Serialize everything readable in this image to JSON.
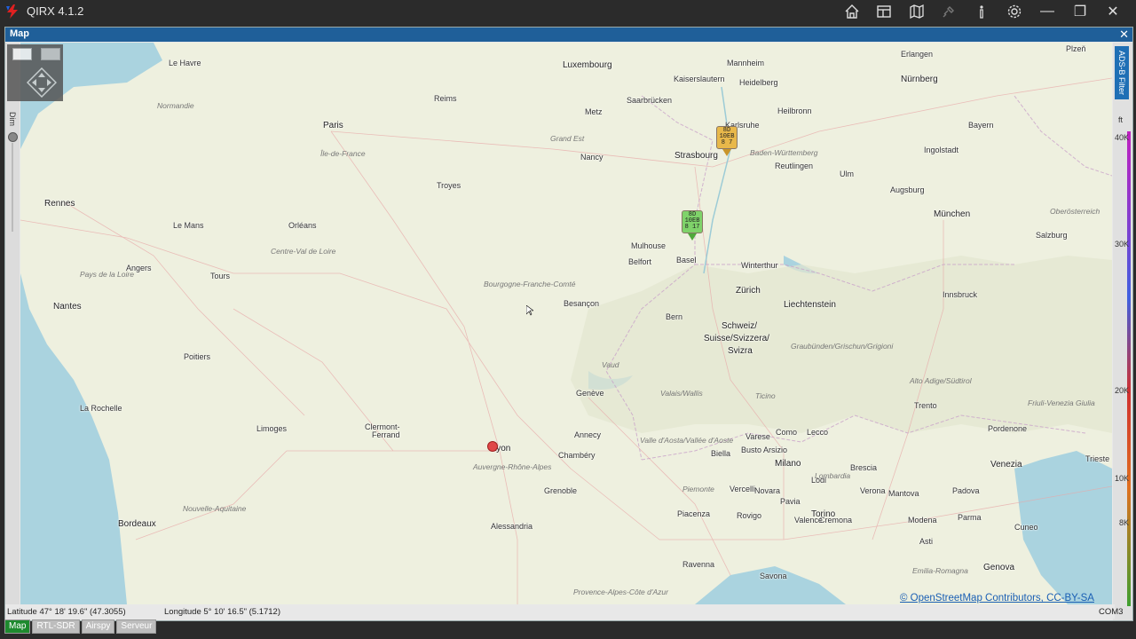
{
  "app": {
    "title": "QIRX 4.1.2"
  },
  "toolbar": {
    "icons": [
      "home-icon",
      "layout-icon",
      "map-icon",
      "satellite-icon",
      "info-icon",
      "gear-icon"
    ]
  },
  "window_controls": {
    "minimize": "—",
    "restore": "❐",
    "close": "✕"
  },
  "panel": {
    "title": "Map",
    "close": "✕"
  },
  "map": {
    "dim_label": "Dim",
    "ads_filter_label": "ADS-B Filter",
    "altitude_unit": "ft",
    "altitude_ticks": [
      "40K",
      "30K",
      "20K",
      "10K",
      "8K"
    ],
    "cities": [
      {
        "name": "Le Havre",
        "big": false
      },
      {
        "name": "Luxembourg",
        "big": true
      },
      {
        "name": "Mannheim",
        "big": false
      },
      {
        "name": "Erlangen",
        "big": false
      },
      {
        "name": "Plzeň",
        "big": false
      },
      {
        "name": "Heidelberg",
        "big": false
      },
      {
        "name": "Nürnberg",
        "big": true
      },
      {
        "name": "Kaiserslautern",
        "big": false
      },
      {
        "name": "Saarbrücken",
        "big": false
      },
      {
        "name": "Reims",
        "big": false
      },
      {
        "name": "Metz",
        "big": false
      },
      {
        "name": "Paris",
        "big": true
      },
      {
        "name": "Karlsruhe",
        "big": false
      },
      {
        "name": "Heilbronn",
        "big": false
      },
      {
        "name": "Bayern",
        "big": false
      },
      {
        "name": "Strasbourg",
        "big": true
      },
      {
        "name": "Reutlingen",
        "big": false
      },
      {
        "name": "Ingolstadt",
        "big": false
      },
      {
        "name": "Nancy",
        "big": false
      },
      {
        "name": "Troyes",
        "big": false
      },
      {
        "name": "Augsburg",
        "big": false
      },
      {
        "name": "Rennes",
        "big": true
      },
      {
        "name": "Ulm",
        "big": false
      },
      {
        "name": "München",
        "big": true
      },
      {
        "name": "Le Mans",
        "big": false
      },
      {
        "name": "Orléans",
        "big": false
      },
      {
        "name": "Mulhouse",
        "big": false
      },
      {
        "name": "Salzburg",
        "big": false
      },
      {
        "name": "Belfort",
        "big": false
      },
      {
        "name": "Basel",
        "big": false
      },
      {
        "name": "Winterthur",
        "big": false
      },
      {
        "name": "Angers",
        "big": false
      },
      {
        "name": "Tours",
        "big": false
      },
      {
        "name": "Zürich",
        "big": true
      },
      {
        "name": "Innsbruck",
        "big": false
      },
      {
        "name": "Nantes",
        "big": true
      },
      {
        "name": "Besançon",
        "big": false
      },
      {
        "name": "Liechtenstein",
        "big": true
      },
      {
        "name": "Bern",
        "big": false
      },
      {
        "name": "Schweiz/",
        "big": true
      },
      {
        "name": "Suisse/Svizzera/",
        "big": true
      },
      {
        "name": "Svizra",
        "big": true
      },
      {
        "name": "Poitiers",
        "big": false
      },
      {
        "name": "Genève",
        "big": false
      },
      {
        "name": "Trento",
        "big": false
      },
      {
        "name": "La Rochelle",
        "big": false
      },
      {
        "name": "Limoges",
        "big": false
      },
      {
        "name": "Clermont-",
        "big": false
      },
      {
        "name": "Ferrand",
        "big": false
      },
      {
        "name": "Annecy",
        "big": false
      },
      {
        "name": "Como",
        "big": false
      },
      {
        "name": "Lecco",
        "big": false
      },
      {
        "name": "Varese",
        "big": false
      },
      {
        "name": "Pordenone",
        "big": false
      },
      {
        "name": "Lyon",
        "big": true
      },
      {
        "name": "Chambéry",
        "big": false
      },
      {
        "name": "Biella",
        "big": false
      },
      {
        "name": "Busto Arsizio",
        "big": false
      },
      {
        "name": "Milano",
        "big": true
      },
      {
        "name": "Brescia",
        "big": false
      },
      {
        "name": "Verona",
        "big": false
      },
      {
        "name": "Padova",
        "big": false
      },
      {
        "name": "Venezia",
        "big": true
      },
      {
        "name": "Trieste",
        "big": false
      },
      {
        "name": "Grenoble",
        "big": false
      },
      {
        "name": "Lodi",
        "big": false
      },
      {
        "name": "Vercelli",
        "big": false
      },
      {
        "name": "Novara",
        "big": false
      },
      {
        "name": "Bordeaux",
        "big": true
      },
      {
        "name": "Cremona",
        "big": false
      },
      {
        "name": "Mantova",
        "big": false
      },
      {
        "name": "Pavia",
        "big": false
      },
      {
        "name": "Torino",
        "big": true
      },
      {
        "name": "Piacenza",
        "big": false
      },
      {
        "name": "Valence",
        "big": false
      },
      {
        "name": "Alessandria",
        "big": false
      },
      {
        "name": "Rovigo",
        "big": false
      },
      {
        "name": "Parma",
        "big": false
      },
      {
        "name": "Modena",
        "big": false
      },
      {
        "name": "Asti",
        "big": false
      },
      {
        "name": "Cuneo",
        "big": false
      },
      {
        "name": "Ravenna",
        "big": false
      },
      {
        "name": "Genova",
        "big": true
      },
      {
        "name": "Savona",
        "big": false
      }
    ],
    "regions": [
      "Normandie",
      "Île-de-France",
      "Grand Est",
      "Baden-Württemberg",
      "Centre-Val de Loire",
      "Pays de la Loire",
      "Bourgogne-Franche-Comté",
      "Auvergne-Rhône-Alpes",
      "Nouvelle-Aquitaine",
      "Lombardia",
      "Piemonte",
      "Emilia-Romagna",
      "Provence-Alpes-Côte d'Azur",
      "Vaud",
      "Valais/Wallis",
      "Ticino",
      "Graubünden/Grischun/Grigioni",
      "Valle d'Aosta/Vallée d'Aoste",
      "Alto Adige/Südtirol",
      "Friuli-Venezia Giulia",
      "Oberösterreich"
    ],
    "aircraft": [
      {
        "lines": [
          "8D",
          "10EB",
          "8 7"
        ],
        "color": "#e8b84a",
        "tip": "#c8952a"
      },
      {
        "lines": [
          "8D",
          "10EB",
          "8 17"
        ],
        "color": "#7fd36a",
        "tip": "#4fa83a"
      }
    ],
    "attribution": "© OpenStreetMap Contributors, CC-BY-SA"
  },
  "status": {
    "latitude": "Latitude  47° 18' 19.6\" (47.3055)",
    "longitude": "Longitude  5° 10' 16.5\" (5.1712)",
    "port": "COM3"
  },
  "tabs": [
    {
      "label": "Map",
      "active": true
    },
    {
      "label": "RTL-SDR",
      "active": false
    },
    {
      "label": "Airspy",
      "active": false
    },
    {
      "label": "Serveur",
      "active": false
    }
  ]
}
